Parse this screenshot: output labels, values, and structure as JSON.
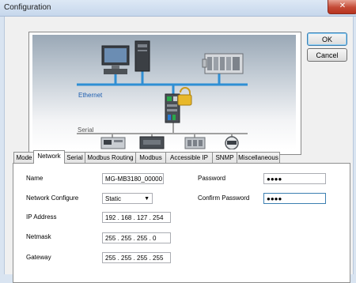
{
  "window": {
    "title": "Configuration",
    "close_glyph": "✕"
  },
  "buttons": {
    "ok": "OK",
    "cancel": "Cancel"
  },
  "diagram": {
    "ethernet_label": "Ethernet",
    "serial_label": "Serial"
  },
  "tabs": [
    {
      "label": "Mode"
    },
    {
      "label": "Network",
      "active": true
    },
    {
      "label": "Serial"
    },
    {
      "label": "Modbus Routing"
    },
    {
      "label": "Modbus"
    },
    {
      "label": "Accessible IP"
    },
    {
      "label": "SNMP"
    },
    {
      "label": "Miscellaneous"
    }
  ],
  "form": {
    "name_label": "Name",
    "name_value": "MG-MB3180_00000",
    "network_configure_label": "Network Configure",
    "network_configure_value": "Static",
    "ip_label": "IP Address",
    "ip_value": "192 . 168 . 127 . 254",
    "netmask_label": "Netmask",
    "netmask_value": "255 . 255 . 255 . 0",
    "gateway_label": "Gateway",
    "gateway_value": "255 . 255 . 255 . 255",
    "password_label": "Password",
    "password_value": "●●●●",
    "confirm_password_label": "Confirm Password",
    "confirm_password_value": "●●●●"
  },
  "icons": [
    "close-icon",
    "computer-icon",
    "tower-pc-icon",
    "plc-rack-icon",
    "gateway-device-icon",
    "lock-icon",
    "serial-meter-icon",
    "serial-controller-icon",
    "serial-io-icon",
    "serial-gauge-icon",
    "dropdown-caret-icon"
  ],
  "colors": {
    "ethernet_line": "#2f8fd4",
    "serial_line": "#a0a0a0",
    "default_button_border": "#3c7fb1"
  }
}
